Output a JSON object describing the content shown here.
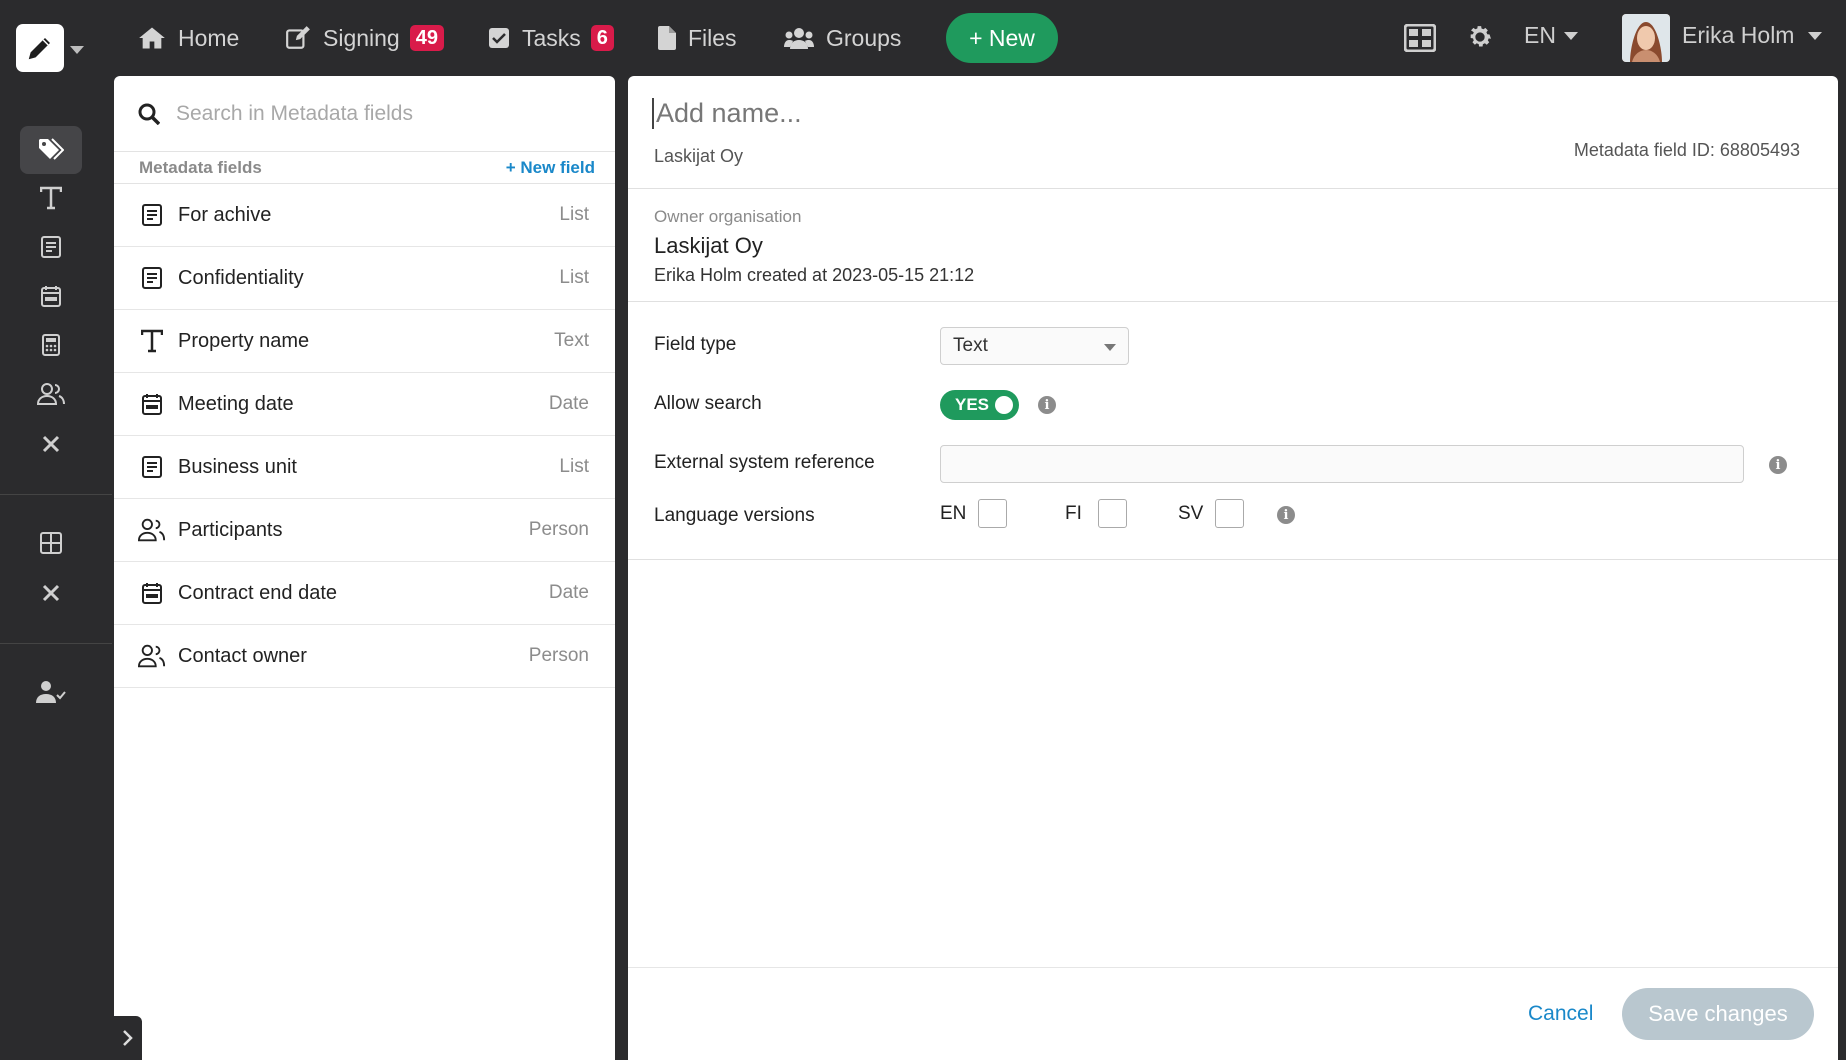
{
  "nav": {
    "home": "Home",
    "signing": "Signing",
    "signing_count": "49",
    "tasks": "Tasks",
    "tasks_count": "6",
    "files": "Files",
    "groups": "Groups",
    "new_button": "+ New",
    "language": "EN",
    "user_name": "Erika Holm"
  },
  "rail": {
    "icons": [
      "tags-icon",
      "text-icon",
      "list-icon",
      "calendar-icon",
      "calculator-icon",
      "people-icon",
      "close-icon",
      "grid-icon",
      "close-icon",
      "user-check-icon"
    ]
  },
  "left_panel": {
    "search_placeholder": "Search in Metadata fields",
    "header_label": "Metadata fields",
    "new_field": "+ New field",
    "fields": [
      {
        "name": "For achive",
        "type": "List",
        "icon": "list-icon"
      },
      {
        "name": "Confidentiality",
        "type": "List",
        "icon": "list-icon"
      },
      {
        "name": "Property name",
        "type": "Text",
        "icon": "text-icon"
      },
      {
        "name": "Meeting date",
        "type": "Date",
        "icon": "calendar-icon"
      },
      {
        "name": "Business unit",
        "type": "List",
        "icon": "list-icon"
      },
      {
        "name": "Participants",
        "type": "Person",
        "icon": "people-icon"
      },
      {
        "name": "Contract end date",
        "type": "Date",
        "icon": "calendar-icon"
      },
      {
        "name": "Contact owner",
        "type": "Person",
        "icon": "people-icon"
      }
    ]
  },
  "detail": {
    "name_placeholder": "Add name...",
    "organisation": "Laskijat Oy",
    "field_id_text": "Metadata field ID: 68805493",
    "owner_label": "Owner organisation",
    "owner_name": "Laskijat Oy",
    "created_text": "Erika Holm created at 2023-05-15 21:12",
    "field_type_label": "Field type",
    "field_type_value": "Text",
    "allow_search_label": "Allow search",
    "allow_search_value": "YES",
    "external_ref_label": "External system reference",
    "external_ref_value": "",
    "language_versions_label": "Language versions",
    "languages": [
      "EN",
      "FI",
      "SV"
    ],
    "cancel": "Cancel",
    "save": "Save changes"
  },
  "colors": {
    "accent_green": "#1f9a5d",
    "link_blue": "#1a88c9",
    "badge_red": "#d91b4a",
    "sidebar_dark": "#2b2b2d"
  }
}
